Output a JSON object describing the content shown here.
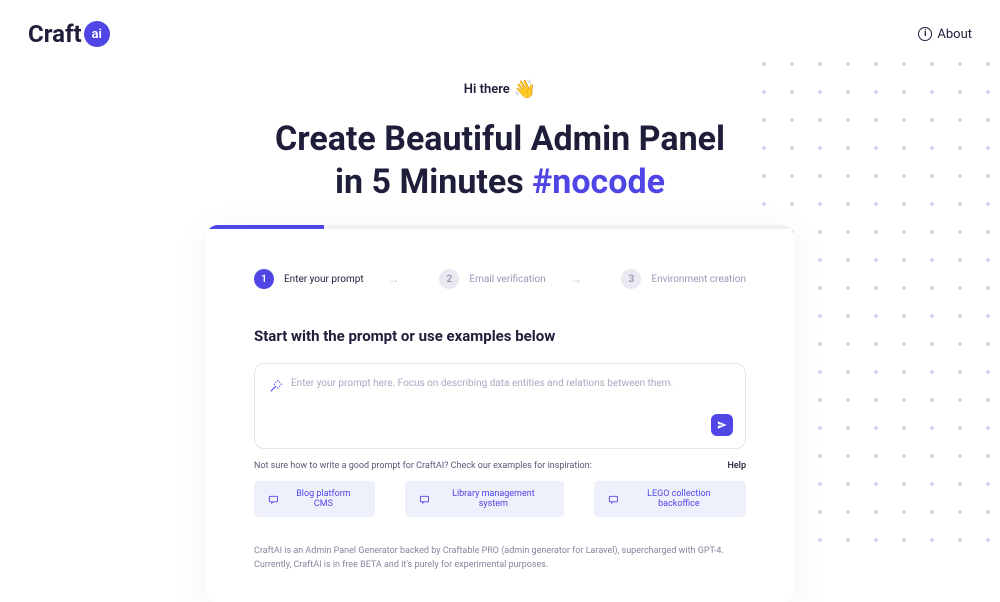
{
  "header": {
    "logo_text": "Craft",
    "logo_badge": "ai",
    "about_label": "About"
  },
  "hero": {
    "greeting": "Hi there",
    "wave_emoji": "👋",
    "title_line1": "Create Beautiful Admin Panel",
    "title_line2_prefix": "in 5 Minutes ",
    "hashtag": "#nocode"
  },
  "steps": [
    {
      "num": "1",
      "label": "Enter your prompt",
      "active": true
    },
    {
      "num": "2",
      "label": "Email verification",
      "active": false
    },
    {
      "num": "3",
      "label": "Environment creation",
      "active": false
    }
  ],
  "prompt": {
    "heading": "Start with the prompt or use examples below",
    "placeholder": "Enter your prompt here. Focus on describing data entities and relations between them.",
    "help_text": "Not sure how to write a good prompt for CraftAI? Check our examples for inspiration:",
    "help_link": "Help"
  },
  "examples": [
    "Blog platform CMS",
    "Library management system",
    "LEGO collection backoffice"
  ],
  "footer": "CraftAI is an Admin Panel Generator backed by Craftable PRO (admin generator for Laravel), supercharged with GPT-4. Currently, CraftAI is in free BETA and it's purely for experimental purposes."
}
